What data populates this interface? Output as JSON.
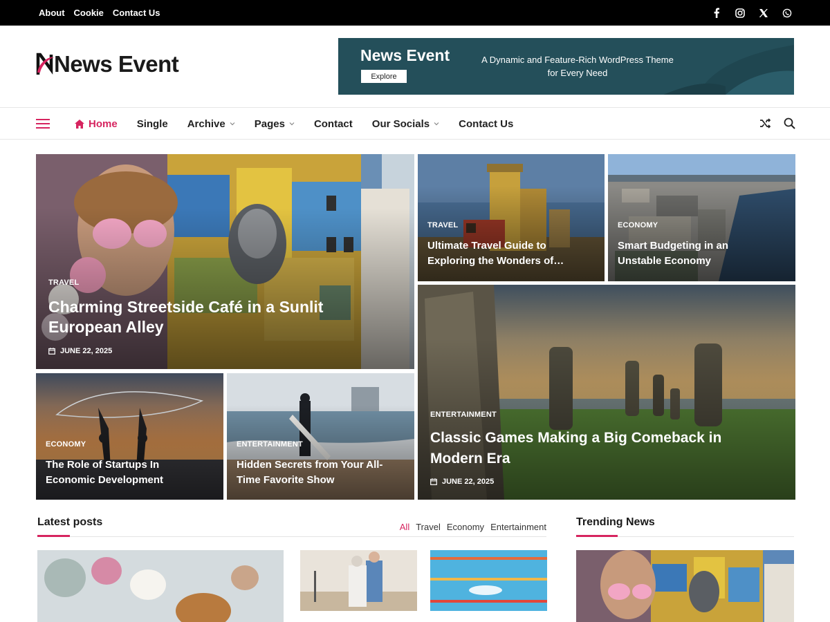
{
  "topbar": {
    "links": [
      "About",
      "Cookie",
      "Contact Us"
    ],
    "social_icons": [
      "facebook-icon",
      "instagram-icon",
      "x-icon",
      "whatsapp-icon"
    ]
  },
  "site": {
    "logo_text": "News Event",
    "brand_color": "#d6245f"
  },
  "banner": {
    "title": "News Event",
    "button": "Explore",
    "tagline_line1": "A Dynamic and Feature-Rich WordPress Theme",
    "tagline_line2": "for Every Need"
  },
  "nav": {
    "items": [
      {
        "label": "Home",
        "active": true,
        "dropdown": false
      },
      {
        "label": "Single",
        "active": false,
        "dropdown": false
      },
      {
        "label": "Archive",
        "active": false,
        "dropdown": true
      },
      {
        "label": "Pages",
        "active": false,
        "dropdown": true
      },
      {
        "label": "Contact",
        "active": false,
        "dropdown": false
      },
      {
        "label": "Our Socials",
        "active": false,
        "dropdown": true
      },
      {
        "label": "Contact Us",
        "active": false,
        "dropdown": false
      }
    ]
  },
  "hero": {
    "main": {
      "category": "TRAVEL",
      "title": "Charming Streetside Café in a Sunlit European Alley",
      "date": "JUNE 22, 2025"
    },
    "top_a": {
      "category": "TRAVEL",
      "title_line1": "Ultimate Travel Guide to",
      "title_line2": "Exploring the Wonders of…"
    },
    "top_b": {
      "category": "ECONOMY",
      "title_line1": "Smart Budgeting in an",
      "title_line2": "Unstable Economy"
    },
    "big": {
      "category": "ENTERTAINMENT",
      "title": "Classic Games Making a Big Comeback in Modern Era",
      "date": "JUNE 22, 2025"
    },
    "bottom_a": {
      "category": "ECONOMY",
      "title_line1": "The Role of Startups In",
      "title_line2": "Economic Development"
    },
    "bottom_b": {
      "category": "ENTERTAINMENT",
      "title_line1": "Hidden Secrets from Your All-",
      "title_line2": "Time Favorite Show"
    }
  },
  "latest": {
    "title": "Latest posts",
    "filters": [
      "All",
      "Travel",
      "Economy",
      "Entertainment"
    ]
  },
  "trending": {
    "title": "Trending News"
  }
}
